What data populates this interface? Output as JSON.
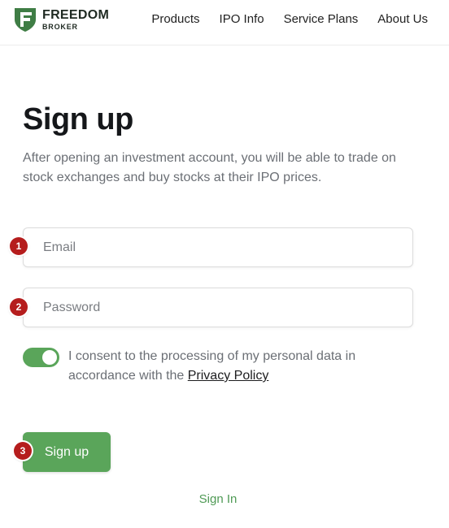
{
  "brand": {
    "line1": "FREEDOM",
    "line2": "BROKER",
    "mark_icon": "freedom-shield-logo",
    "accent": "#5aa55a"
  },
  "nav": {
    "items": [
      "Products",
      "IPO Info",
      "Service Plans",
      "About Us"
    ]
  },
  "main": {
    "title": "Sign up",
    "subtitle": "After opening an investment account, you will be able to trade on stock exchanges and buy stocks at their IPO prices.",
    "email": {
      "placeholder": "Email",
      "value": ""
    },
    "password": {
      "placeholder": "Password",
      "value": ""
    },
    "consent": {
      "checked": true,
      "text": "I consent to the processing of my personal data in accordance with the ",
      "link": "Privacy Policy"
    },
    "submit_label": "Sign up",
    "signin_label": "Sign In"
  },
  "badges": [
    "1",
    "2",
    "3"
  ],
  "colors": {
    "badge": "#b51d1d",
    "button": "#5aa55a",
    "link_green": "#4f9a55"
  }
}
